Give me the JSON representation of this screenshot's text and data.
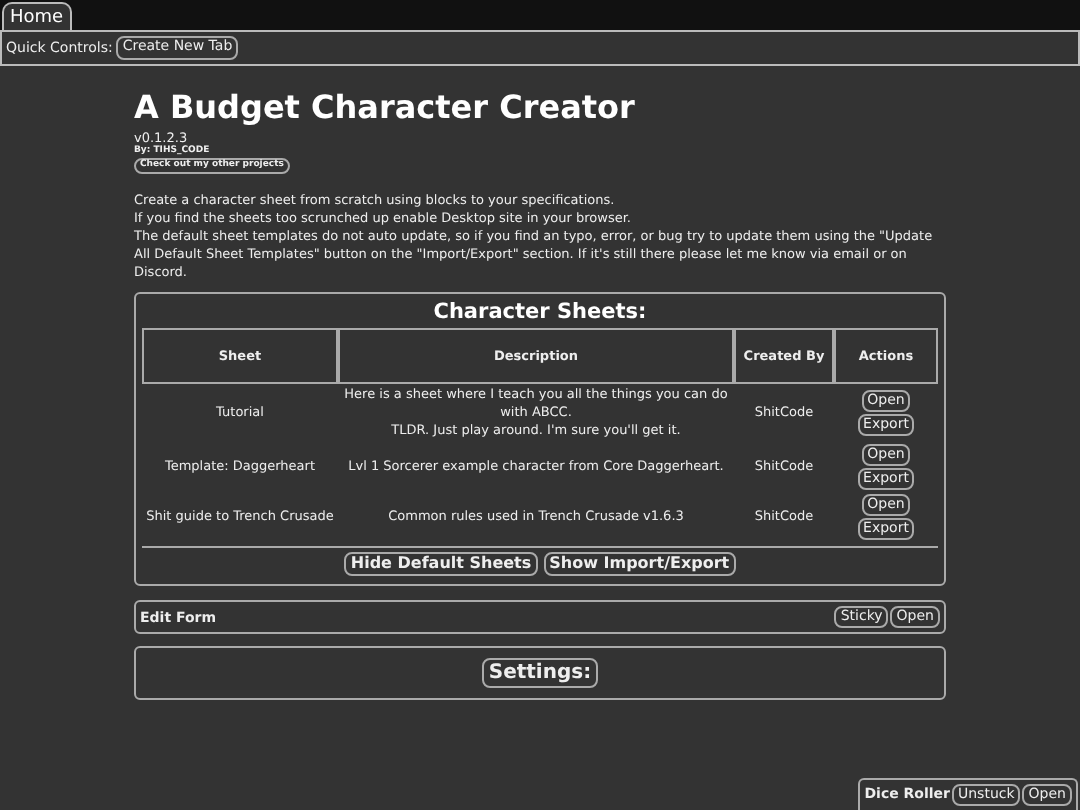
{
  "top_tabs": [
    {
      "label": "Home",
      "selected": true
    }
  ],
  "quick_controls": {
    "label": "Quick Controls:",
    "buttons": [
      "Create New Tab"
    ]
  },
  "header": {
    "title": "A Budget Character Creator",
    "version": "v0.1.2.3",
    "author": "By: TIHS_CODE",
    "projects_button": "Check out my other projects"
  },
  "intro": [
    "Create a character sheet from scratch using blocks to your specifications.",
    "If you find the sheets too scrunched up enable Desktop site in your browser.",
    "The default sheet templates do not auto update, so if you find an typo, error, or bug try to update them using the \"Update All Default Sheet Templates\" button on the \"Import/Export\" section. If it's still there please let me know via email or on Discord."
  ],
  "sheets_panel": {
    "title": "Character Sheets:",
    "columns": [
      "Sheet",
      "Description",
      "Created By",
      "Actions"
    ],
    "rows": [
      {
        "sheet": "Tutorial",
        "description": [
          "Here is a sheet where I teach you all the things you can do with ABCC.",
          "TLDR. Just play around. I'm sure you'll get it."
        ],
        "created_by": "ShitCode",
        "actions": [
          "Open",
          "Export"
        ]
      },
      {
        "sheet": "Template: Daggerheart",
        "description": [
          "Lvl 1 Sorcerer example character from Core Daggerheart."
        ],
        "created_by": "ShitCode",
        "actions": [
          "Open",
          "Export"
        ]
      },
      {
        "sheet": "Shit guide to Trench Crusade",
        "description": [
          "Common rules used in Trench Crusade v1.6.3"
        ],
        "created_by": "ShitCode",
        "actions": [
          "Open",
          "Export"
        ]
      }
    ],
    "buttons": [
      "Hide Default Sheets",
      "Show Import/Export"
    ]
  },
  "edit_form": {
    "title": "Edit Form",
    "buttons": [
      "Sticky",
      "Open"
    ]
  },
  "settings": {
    "title": "Settings:"
  },
  "dice_roller": {
    "title": "Dice Roller",
    "buttons": [
      "Unstuck",
      "Open"
    ]
  }
}
